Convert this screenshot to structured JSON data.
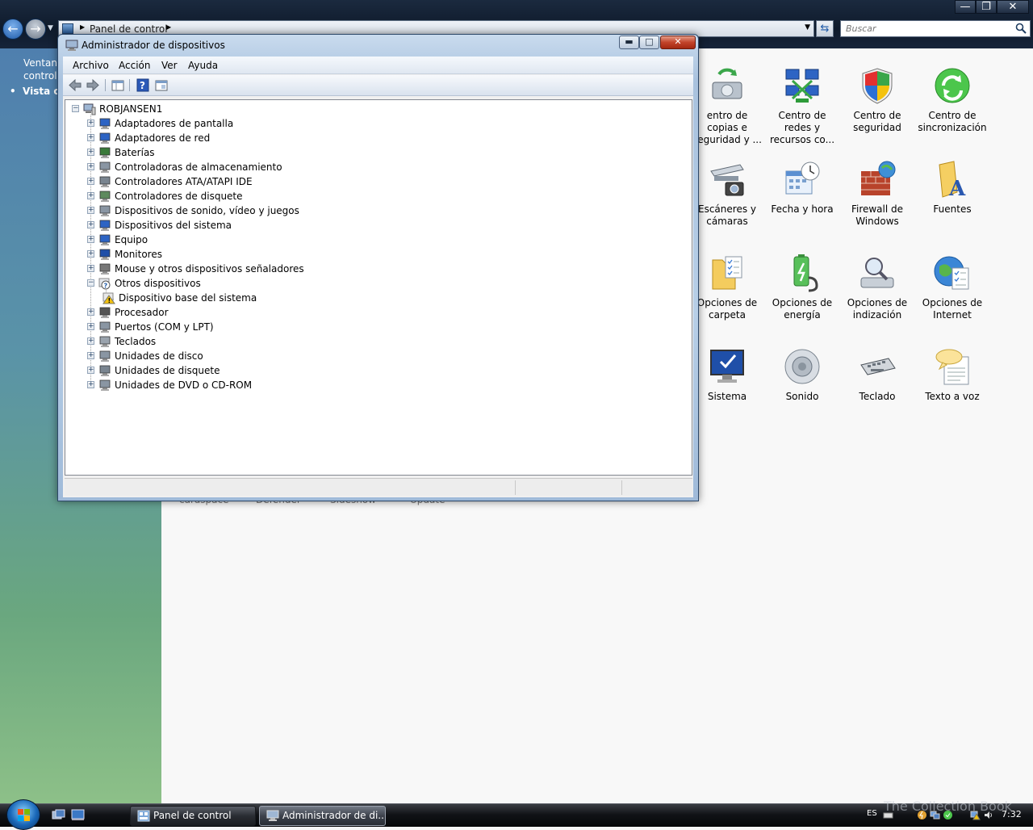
{
  "control_panel": {
    "address_crumb": "Panel de control",
    "search_placeholder": "Buscar",
    "sidebar_title_line1": "Ventana",
    "sidebar_title_line2": "control",
    "sidebar_item": "Vista cl",
    "items": [
      {
        "label": "entro de copias e seguridad y ...",
        "icon": "backup-icon"
      },
      {
        "label": "Centro de redes y recursos co...",
        "icon": "network-icon"
      },
      {
        "label": "Centro de seguridad",
        "icon": "security-shield-icon"
      },
      {
        "label": "Centro de sincronización",
        "icon": "sync-icon"
      },
      {
        "label": "Escáneres y cámaras",
        "icon": "scanner-icon"
      },
      {
        "label": "Fecha y hora",
        "icon": "calendar-clock-icon"
      },
      {
        "label": "Firewall de Windows",
        "icon": "firewall-icon"
      },
      {
        "label": "Fuentes",
        "icon": "fonts-folder-icon"
      },
      {
        "label": "Opciones de carpeta",
        "icon": "folder-options-icon"
      },
      {
        "label": "Opciones de energía",
        "icon": "power-icon"
      },
      {
        "label": "Opciones de indización",
        "icon": "indexing-icon"
      },
      {
        "label": "Opciones de Internet",
        "icon": "internet-options-icon"
      },
      {
        "label": "Sistema",
        "icon": "system-icon"
      },
      {
        "label": "Sonido",
        "icon": "speaker-icon"
      },
      {
        "label": "Teclado",
        "icon": "keyboard-icon"
      },
      {
        "label": "Texto a voz",
        "icon": "speech-icon"
      }
    ],
    "ghost_labels": [
      "cardspace",
      "Defender",
      "Sideshow",
      "Update"
    ]
  },
  "device_manager": {
    "title": "Administrador de dispositivos",
    "menu": [
      "Archivo",
      "Acción",
      "Ver",
      "Ayuda"
    ],
    "toolbar_icons": [
      "back-arrow-icon",
      "forward-arrow-icon",
      "properties-icon",
      "help-icon",
      "view-icon"
    ],
    "root": "ROBJANSEN1",
    "nodes": [
      {
        "label": "Adaptadores de pantalla",
        "icon": "display-adapter-icon"
      },
      {
        "label": "Adaptadores de red",
        "icon": "network-adapter-icon"
      },
      {
        "label": "Baterías",
        "icon": "battery-icon"
      },
      {
        "label": "Controladoras de almacenamiento",
        "icon": "storage-controller-icon"
      },
      {
        "label": "Controladores ATA/ATAPI IDE",
        "icon": "ide-controller-icon"
      },
      {
        "label": "Controladores de disquete",
        "icon": "floppy-controller-icon"
      },
      {
        "label": "Dispositivos de sonido, vídeo y juegos",
        "icon": "sound-device-icon"
      },
      {
        "label": "Dispositivos del sistema",
        "icon": "system-device-icon"
      },
      {
        "label": "Equipo",
        "icon": "computer-icon"
      },
      {
        "label": "Monitores",
        "icon": "monitor-icon"
      },
      {
        "label": "Mouse y otros dispositivos señaladores",
        "icon": "mouse-icon"
      },
      {
        "label": "Otros dispositivos",
        "icon": "unknown-device-icon",
        "expanded": true
      },
      {
        "label": "Dispositivo base del sistema",
        "icon": "warning-device-icon",
        "child": true
      },
      {
        "label": "Procesador",
        "icon": "processor-icon"
      },
      {
        "label": "Puertos (COM y LPT)",
        "icon": "port-icon"
      },
      {
        "label": "Teclados",
        "icon": "keyboard-device-icon"
      },
      {
        "label": "Unidades de disco",
        "icon": "disk-drive-icon"
      },
      {
        "label": "Unidades de disquete",
        "icon": "floppy-drive-icon"
      },
      {
        "label": "Unidades de DVD o CD-ROM",
        "icon": "dvd-drive-icon"
      }
    ]
  },
  "taskbar": {
    "buttons": [
      {
        "label": "Panel de control",
        "active": false
      },
      {
        "label": "Administrador de di...",
        "active": true
      }
    ],
    "language": "ES",
    "clock": "7:32",
    "watermark": "The Collection Book"
  },
  "colors": {
    "accent": "#1e5aa8",
    "sidebar_top": "#4f7fae",
    "sidebar_bottom": "#8dc088",
    "taskbar": "#111317"
  }
}
